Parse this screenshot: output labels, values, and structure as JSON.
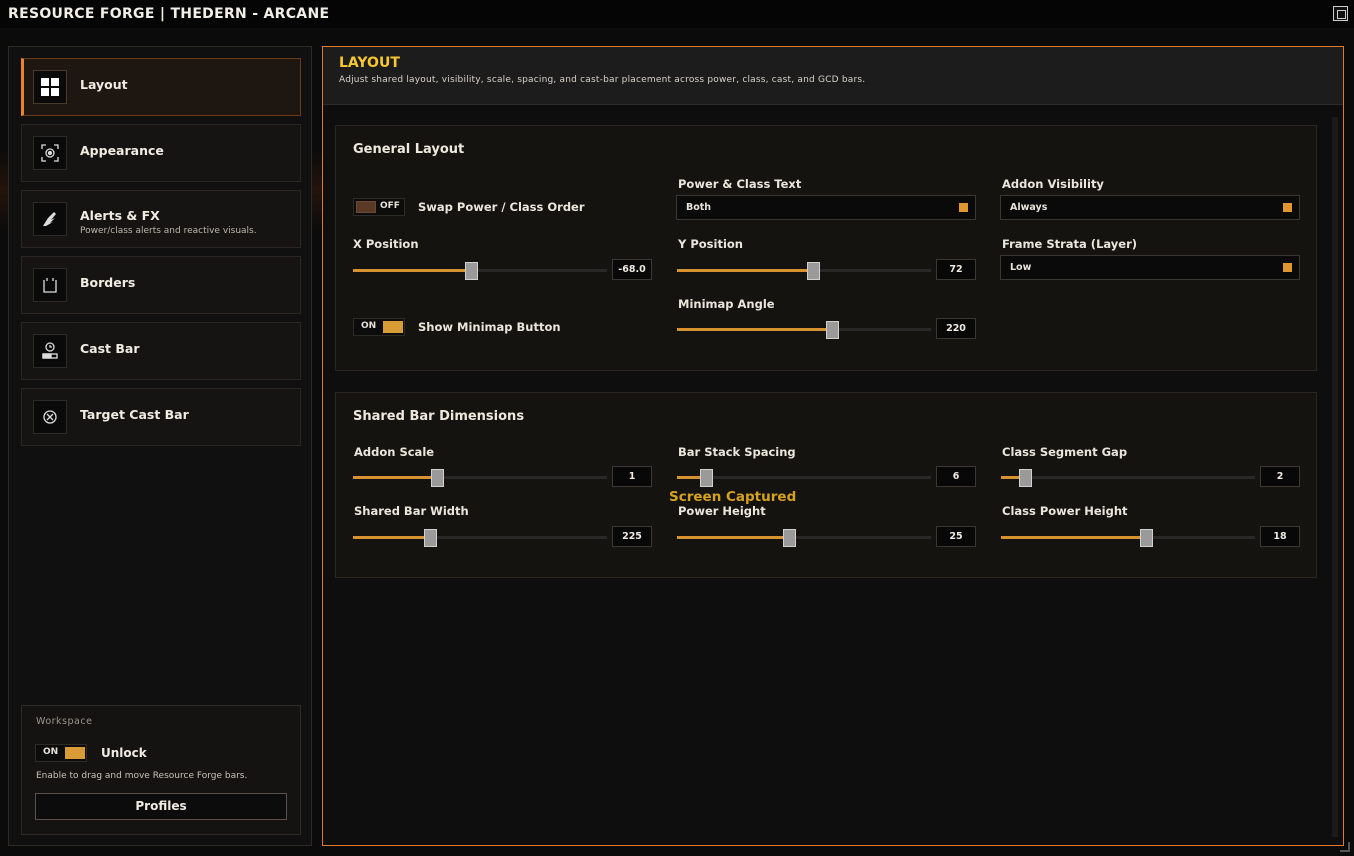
{
  "window": {
    "title": "RESOURCE FORGE | THEDERN - ARCANE"
  },
  "sidebar": {
    "items": [
      {
        "label": "Layout",
        "icon": "grid-icon",
        "active": true
      },
      {
        "label": "Appearance",
        "icon": "appearance-icon",
        "active": false
      },
      {
        "label": "Alerts & FX",
        "icon": "wing-icon",
        "active": false,
        "subtitle": "Power/class alerts and reactive visuals."
      },
      {
        "label": "Borders",
        "icon": "border-icon",
        "active": false
      },
      {
        "label": "Cast Bar",
        "icon": "cast-bar-icon",
        "active": false
      },
      {
        "label": "Target Cast Bar",
        "icon": "target-icon",
        "active": false
      }
    ],
    "workspace": {
      "title": "Workspace",
      "toggle_state": "ON",
      "toggle_label": "Unlock",
      "description": "Enable to drag and move Resource Forge bars.",
      "profiles_label": "Profiles"
    }
  },
  "header": {
    "title": "LAYOUT",
    "subtitle": "Adjust shared layout, visibility, scale, spacing, and cast-bar placement across power, class, cast, and GCD bars."
  },
  "general_layout": {
    "title": "General Layout",
    "swap_order": {
      "state": "OFF",
      "label": "Swap Power / Class Order"
    },
    "power_class_text": {
      "label": "Power & Class Text",
      "value": "Both"
    },
    "addon_visibility": {
      "label": "Addon Visibility",
      "value": "Always"
    },
    "x_position": {
      "label": "X Position",
      "value": "-68.0",
      "fraction": 0.465
    },
    "y_position": {
      "label": "Y Position",
      "value": "72",
      "fraction": 0.535
    },
    "frame_strata": {
      "label": "Frame Strata (Layer)",
      "value": "Low"
    },
    "minimap_button": {
      "state": "ON",
      "label": "Show Minimap Button"
    },
    "minimap_angle": {
      "label": "Minimap Angle",
      "value": "220",
      "fraction": 0.61
    }
  },
  "shared_dimensions": {
    "title": "Shared Bar Dimensions",
    "addon_scale": {
      "label": "Addon Scale",
      "value": "1",
      "fraction": 0.33
    },
    "bar_stack_spacing": {
      "label": "Bar Stack Spacing",
      "value": "6",
      "fraction": 0.115
    },
    "class_segment_gap": {
      "label": "Class Segment Gap",
      "value": "2",
      "fraction": 0.095
    },
    "shared_bar_width": {
      "label": "Shared Bar Width",
      "value": "225",
      "fraction": 0.305
    },
    "power_height": {
      "label": "Power Height",
      "value": "25",
      "fraction": 0.44
    },
    "class_power_height": {
      "label": "Class Power Height",
      "value": "18",
      "fraction": 0.57
    }
  },
  "overlay": {
    "captured_text": "Screen Captured"
  },
  "colors": {
    "accent": "#e07a2a",
    "header_title": "#f7c733",
    "slider_fill": "#d8912f",
    "toggle_on": "#d89b36"
  }
}
